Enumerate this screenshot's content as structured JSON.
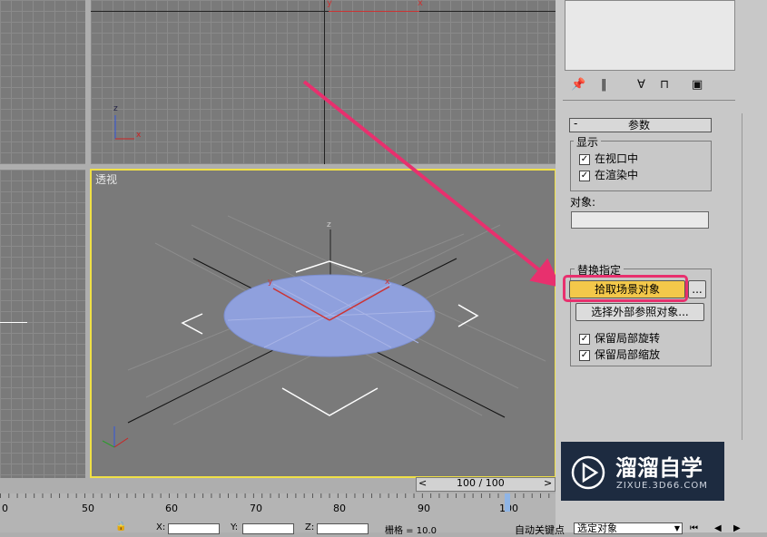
{
  "viewport": {
    "label": "透视",
    "top_axis_labels": {
      "y": "y",
      "x": "x"
    },
    "small_axes": {
      "z": "z",
      "x": "x"
    },
    "persp_axes": {
      "z": "z",
      "y": "y",
      "x": "x"
    }
  },
  "timeline": {
    "position": "100 / 100",
    "ticks": [
      "0",
      "50",
      "60",
      "70",
      "80",
      "90",
      "100"
    ],
    "prev_symbol": "<",
    "next_symbol": ">"
  },
  "status_bar": {
    "x_label": "X:",
    "y_label": "Y:",
    "z_label": "Z:",
    "grid_text": "栅格 = 10.0",
    "auto_key": "自动关键点",
    "select_value": "选定对象"
  },
  "panel": {
    "rollout_minus": "-",
    "rollout_title": "参数",
    "display_group": "显示",
    "chk_in_viewport": "在视口中",
    "chk_in_render": "在渲染中",
    "object_label": "对象:",
    "object_value": "",
    "replace_group": "替换指定",
    "pick_scene_button": "拾取场景对象",
    "ellipsis_button": "...",
    "select_xref_button": "选择外部参照对象...",
    "chk_keep_rotation": "保留局部旋转",
    "chk_keep_scale": "保留局部缩放",
    "checkmark": "✓"
  },
  "watermark": {
    "logo_text": "溜溜自学",
    "url": "ZIXUE.3D66.COM"
  },
  "colors": {
    "active_border": "#f0e046",
    "highlight_button": "#f3c84a",
    "annotation_arrow": "#e8306e",
    "disc": "#8fa0dd"
  }
}
